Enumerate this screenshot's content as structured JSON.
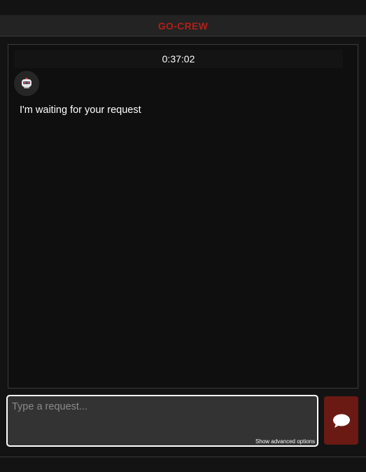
{
  "app": {
    "title": "GO-CREW"
  },
  "chat": {
    "timer": "0:37:02",
    "avatar_icon": "robot-icon",
    "message": "I'm waiting for your request"
  },
  "composer": {
    "placeholder": "Type a request...",
    "value": "",
    "advanced_label": "Show advanced options",
    "send_icon": "chat-bubble-icon"
  },
  "colors": {
    "accent": "#b0201b",
    "send_button": "#6a1a13",
    "background": "#0f0f0f"
  }
}
